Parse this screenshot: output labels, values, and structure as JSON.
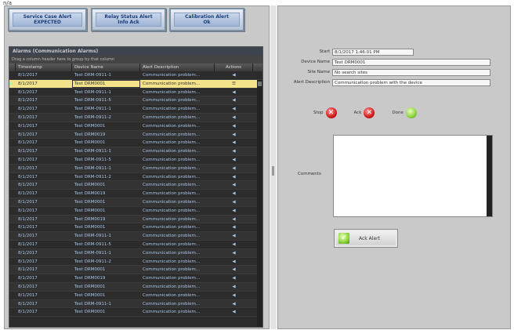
{
  "app_label": "n/a",
  "buttons": [
    {
      "line1": "Service Case Alert",
      "line2": "EXPECTED"
    },
    {
      "line1": "Relay Status Alert",
      "line2": "Info Ack"
    },
    {
      "line1": "Calibration Alert",
      "line2": "Ok"
    }
  ],
  "grid": {
    "title": "Alarms (Communication Alarms)",
    "group_hint": "Drag a column header here to group by that column",
    "columns": [
      "",
      "Timestamp",
      "Device Name",
      "Alert Description",
      "Actions"
    ],
    "rows": [
      {
        "time": "8/1/2017",
        "device": "Test DRM-0911-1",
        "desc": "Communication problem...",
        "act": "◀",
        "selected": false
      },
      {
        "time": "8/1/2017",
        "device": "Test DRM0001",
        "desc": "Communication problem...",
        "act": "☰",
        "selected": true
      },
      {
        "time": "8/1/2017",
        "device": "Test DRM-0911-1",
        "desc": "Communication problem...",
        "act": "◀",
        "selected": false
      },
      {
        "time": "8/1/2017",
        "device": "Test DRM-0911-5",
        "desc": "Communication problem...",
        "act": "◀",
        "selected": false
      },
      {
        "time": "8/1/2017",
        "device": "Test DRM-0911-1",
        "desc": "Communication problem...",
        "act": "◀",
        "selected": false
      },
      {
        "time": "8/1/2017",
        "device": "Test DRM-0911-2",
        "desc": "Communication problem...",
        "act": "◀",
        "selected": false
      },
      {
        "time": "8/1/2017",
        "device": "Test DRM0001",
        "desc": "Communication problem...",
        "act": "◀",
        "selected": false
      },
      {
        "time": "8/1/2017",
        "device": "Test DRM0019",
        "desc": "Communication problem...",
        "act": "◀",
        "selected": false
      },
      {
        "time": "8/1/2017",
        "device": "Test DRM0001",
        "desc": "Communication problem...",
        "act": "◀",
        "selected": false
      },
      {
        "time": "8/1/2017",
        "device": "Test DRM-0911-1",
        "desc": "Communication problem...",
        "act": "◀",
        "selected": false
      },
      {
        "time": "8/1/2017",
        "device": "Test DRM-0911-5",
        "desc": "Communication problem...",
        "act": "◀",
        "selected": false
      },
      {
        "time": "8/1/2017",
        "device": "Test DRM-0911-1",
        "desc": "Communication problem...",
        "act": "◀",
        "selected": false
      },
      {
        "time": "8/1/2017",
        "device": "Test DRM-0911-2",
        "desc": "Communication problem...",
        "act": "◀",
        "selected": false
      },
      {
        "time": "8/1/2017",
        "device": "Test DRM0001",
        "desc": "Communication problem...",
        "act": "◀",
        "selected": false
      },
      {
        "time": "8/1/2017",
        "device": "Test DRM0019",
        "desc": "Communication problem...",
        "act": "◀",
        "selected": false
      },
      {
        "time": "8/1/2017",
        "device": "Test DRM0001",
        "desc": "Communication problem...",
        "act": "◀",
        "selected": false
      },
      {
        "time": "8/1/2017",
        "device": "Test DRM0001",
        "desc": "Communication problem...",
        "act": "◀",
        "selected": false
      },
      {
        "time": "8/1/2017",
        "device": "Test DRM0019",
        "desc": "Communication problem...",
        "act": "◀",
        "selected": false
      },
      {
        "time": "8/1/2017",
        "device": "Test DRM0001",
        "desc": "Communication problem...",
        "act": "◀",
        "selected": false
      },
      {
        "time": "8/1/2017",
        "device": "Test DRM-0911-1",
        "desc": "Communication problem...",
        "act": "◀",
        "selected": false
      },
      {
        "time": "8/1/2017",
        "device": "Test DRM-0911-5",
        "desc": "Communication problem...",
        "act": "◀",
        "selected": false
      },
      {
        "time": "8/1/2017",
        "device": "Test DRM-0911-1",
        "desc": "Communication problem...",
        "act": "◀",
        "selected": false
      },
      {
        "time": "8/1/2017",
        "device": "Test DRM-0911-2",
        "desc": "Communication problem...",
        "act": "◀",
        "selected": false
      },
      {
        "time": "8/1/2017",
        "device": "Test DRM0001",
        "desc": "Communication problem...",
        "act": "◀",
        "selected": false
      },
      {
        "time": "8/1/2017",
        "device": "Test DRM0019",
        "desc": "Communication problem...",
        "act": "◀",
        "selected": false
      },
      {
        "time": "8/1/2017",
        "device": "Test DRM0001",
        "desc": "Communication problem...",
        "act": "◀",
        "selected": false
      },
      {
        "time": "8/1/2017",
        "device": "Test DRM0001",
        "desc": "Communication problem...",
        "act": "◀",
        "selected": false
      },
      {
        "time": "8/1/2017",
        "device": "Test DRM-0911-1",
        "desc": "Communication problem...",
        "act": "◀",
        "selected": false
      },
      {
        "time": "8/1/2017",
        "device": "Test DRM0001",
        "desc": "Communication problem...",
        "act": "◀",
        "selected": false
      }
    ]
  },
  "details": {
    "fields": [
      {
        "label": "Start",
        "value": "8/1/2017 1:46:01 PM"
      },
      {
        "label": "Device Name",
        "value": "Test DRM0001"
      },
      {
        "label": "Site Name",
        "value": "No search sites"
      },
      {
        "label": "Alert Description",
        "value": "Communication problem with the device"
      }
    ],
    "status": [
      {
        "label": "Stop",
        "state": "red"
      },
      {
        "label": "Ack",
        "state": "red"
      },
      {
        "label": "Done",
        "state": "green"
      }
    ],
    "comments_label": "Comments",
    "comments_value": "",
    "ack_button_label": "Ack Alert"
  },
  "colors": {
    "panel_bg": "#c9c9c9",
    "grid_bg": "#2c2c2c",
    "grid_text": "#a7c4e6",
    "selected_row": "#f2e38a"
  }
}
